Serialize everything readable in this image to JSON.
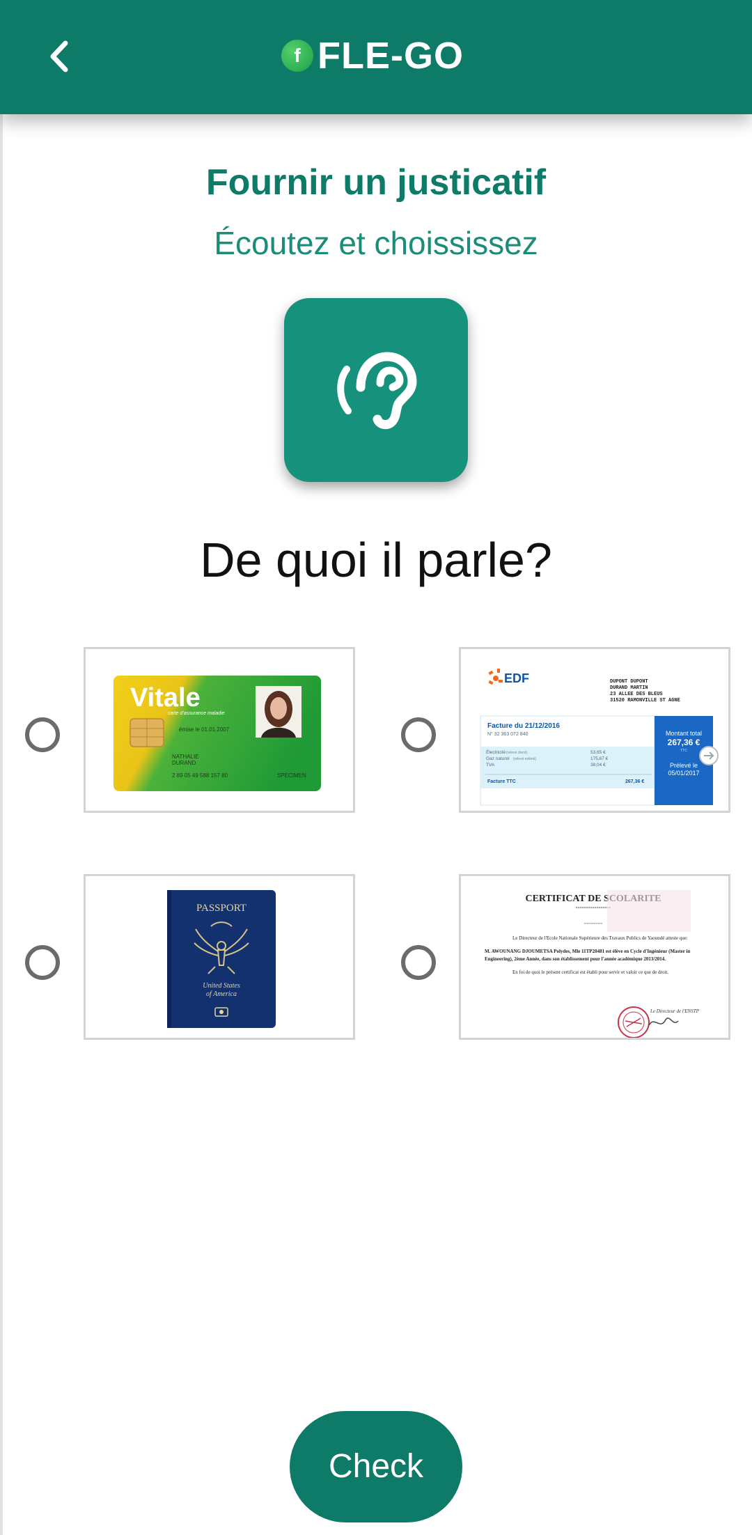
{
  "header": {
    "logo_badge": "f",
    "logo_text": "FLE-GO"
  },
  "title": "Fournir un justicatif",
  "subtitle": "Écoutez et choississez",
  "question": "De quoi il parle?",
  "options": [
    {
      "card": "vitale",
      "brand": "Vitale",
      "tagline": "carte d'assurance maladie",
      "issued": "émise le 01.01.2007",
      "name_first": "NATHALIE",
      "name_last": "DURAND",
      "number": "2 69 05 49 588 157 80",
      "specimen": "SPECIMEN"
    },
    {
      "card": "edf",
      "brand": "EDF",
      "address": [
        "DUPONT DUPONT",
        "DURAND MARTIN",
        "23 ALLEE DES BLEUS",
        "31520 RAMONVILLE ST AGNE"
      ],
      "invoice_title": "Facture du 21/12/2016",
      "invoice_no": "N° 32 363 072 840",
      "lines": [
        {
          "label": "Électricité",
          "note": "(relevé client)",
          "amount": "53,65 €"
        },
        {
          "label": "Gaz naturel",
          "note": "(relevé estimé)",
          "amount": "175,67 €"
        },
        {
          "label": "TVA",
          "note": "",
          "amount": "38,04 €"
        }
      ],
      "total_label": "Facture TTC",
      "total_amount": "267,36 €",
      "box_label": "Montant total",
      "box_amount": "267,36 €",
      "box_ttc": "TTC",
      "box_paid_label": "Prélevé le",
      "box_paid_date": "05/01/2017"
    },
    {
      "card": "passport",
      "title": "PASSPORT",
      "country_line1": "United States",
      "country_line2": "of America"
    },
    {
      "card": "certificat",
      "title": "CERTIFICAT  DE SCOLARITE",
      "stars": "*****************",
      "dashes": "========",
      "para1": "Le Directeur de l'Ecole Nationale Supérieure des Travaux Publics de Yaoundé atteste que:",
      "para2": "M. AWOUNANG DJOUMETSA Polydes, Mle 11TP20481 est élève en Cycle d'Ingénieur (Master in Engineering), 2ème Année, dans son établissement pour l'année académique 2013/2014.",
      "para3": "En foi de quoi le présent certificat est établi pour servir et valoir ce que de droit.",
      "signature_label": "Le Directeur de l'ENSTP"
    }
  ],
  "check_label": "Check",
  "colors": {
    "primary": "#0e7a68",
    "icon_bg": "#16917c",
    "radio": "#6b6b6b"
  },
  "icons": {
    "back": "chevron-left-icon",
    "listen": "ear-listen-icon"
  }
}
